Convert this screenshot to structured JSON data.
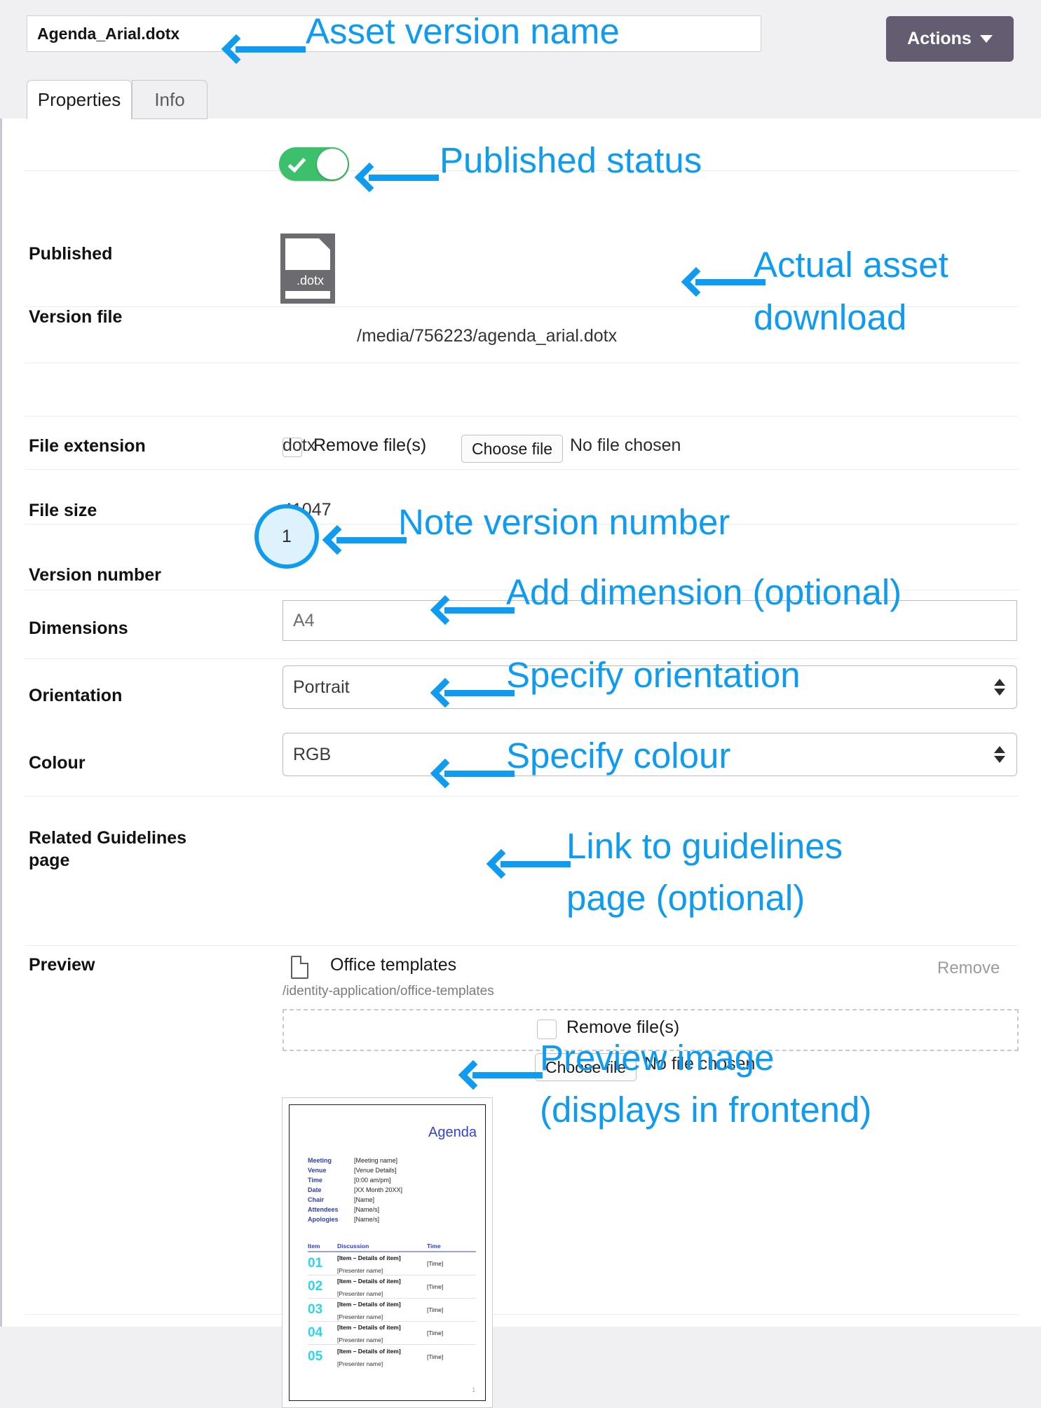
{
  "header": {
    "asset_name": "Agenda_Arial.dotx",
    "actions_label": "Actions"
  },
  "tabs": [
    {
      "label": "Properties",
      "active": true
    },
    {
      "label": "Info",
      "active": false
    }
  ],
  "fields": {
    "published": {
      "label": "Published",
      "state": "on"
    },
    "version_file": {
      "label": "Version file",
      "file_badge": ".dotx",
      "path": "/media/756223/agenda_arial.dotx",
      "remove_label": "Remove file(s)",
      "choose_label": "Choose file",
      "chosen_status": "No file chosen"
    },
    "file_extension": {
      "label": "File extension",
      "value": "dotx"
    },
    "file_size": {
      "label": "File size",
      "value": "41047"
    },
    "version_number": {
      "label": "Version number",
      "value": "1"
    },
    "dimensions": {
      "label": "Dimensions",
      "value": "A4"
    },
    "orientation": {
      "label": "Orientation",
      "value": "Portrait"
    },
    "colour": {
      "label": "Colour",
      "value": "RGB"
    },
    "related_guidelines": {
      "label": "Related Guidelines page",
      "link_title": "Office templates",
      "link_url": "/identity-application/office-templates",
      "remove_label": "Remove"
    },
    "preview": {
      "label": "Preview",
      "remove_label": "Remove file(s)",
      "choose_label": "Choose file",
      "chosen_status": "No file chosen"
    }
  },
  "preview_document": {
    "title": "Agenda",
    "meta": [
      {
        "key": "Meeting",
        "value": "[Meeting name]"
      },
      {
        "key": "Venue",
        "value": "[Venue Details]"
      },
      {
        "key": "Time",
        "value": "[0:00 am/pm]"
      },
      {
        "key": "Date",
        "value": "[XX Month 20XX]"
      },
      {
        "key": "Chair",
        "value": "[Name]"
      },
      {
        "key": "Attendees",
        "value": "[Name/s]"
      },
      {
        "key": "Apologies",
        "value": "[Name/s]"
      }
    ],
    "table_headers": [
      "Item",
      "Discussion",
      "Time"
    ],
    "rows": [
      {
        "num": "01",
        "detail": "[Item – Details of item]",
        "presenter": "[Presenter name]",
        "time": "[Time]"
      },
      {
        "num": "02",
        "detail": "[Item – Details of item]",
        "presenter": "[Presenter name]",
        "time": "[Time]"
      },
      {
        "num": "03",
        "detail": "[Item – Details of item]",
        "presenter": "[Presenter name]",
        "time": "[Time]"
      },
      {
        "num": "04",
        "detail": "[Item – Details of item]",
        "presenter": "[Presenter name]",
        "time": "[Time]"
      },
      {
        "num": "05",
        "detail": "[Item – Details of item]",
        "presenter": "[Presenter name]",
        "time": "[Time]"
      }
    ],
    "page_number": "1"
  },
  "annotations": {
    "asset_version_name": "Asset version name",
    "published_status": "Published status",
    "actual_asset_download_l1": "Actual asset",
    "actual_asset_download_l2": "download",
    "note_version_number": "Note version number",
    "add_dimension": "Add dimension (optional)",
    "specify_orientation": "Specify orientation",
    "specify_colour": "Specify colour",
    "link_to_guidelines_l1": "Link to guidelines",
    "link_to_guidelines_l2": "page (optional)",
    "preview_image_l1": "Preview image",
    "preview_image_l2": "(displays in frontend)"
  },
  "colors": {
    "accent_blue": "#0f9bf0",
    "toggle_green": "#3dc06c",
    "actions_purple": "#645d71",
    "doc_blue": "#3344cc",
    "doc_cyan": "#2fd4e8"
  }
}
